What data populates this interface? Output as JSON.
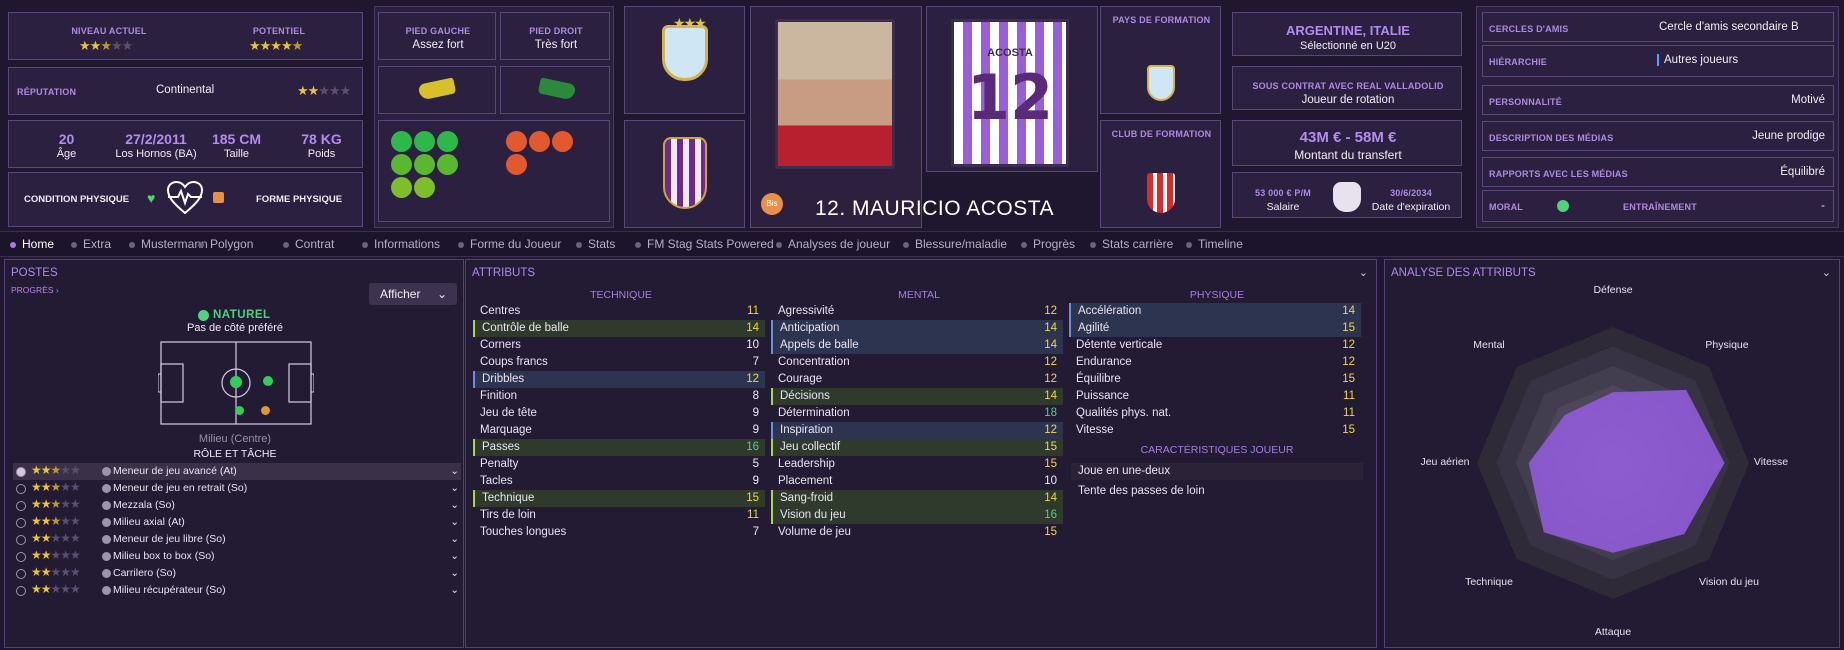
{
  "header": {
    "niveau_label": "NIVEAU ACTUEL",
    "potentiel_label": "POTENTIEL",
    "reputation_label": "RÉPUTATION",
    "reputation_value": "Continental",
    "age": "20",
    "age_label": "Âge",
    "birth": "27/2/2011",
    "birthplace": "Los Hornos (BA)",
    "height": "185 CM",
    "height_label": "Taille",
    "weight": "78 KG",
    "weight_label": "Poids",
    "condition_label": "CONDITION PHYSIQUE",
    "forme_label": "FORME PHYSIQUE",
    "pied_gauche_label": "PIED GAUCHE",
    "pied_gauche": "Assez fort",
    "pied_droit_label": "PIED DROIT",
    "pied_droit": "Très fort",
    "shirt_name": "ACOSTA",
    "shirt_number": "12",
    "player_title": "12. MAURICIO ACOSTA",
    "bis_badge": "Bis",
    "pays_formation_label": "PAYS DE FORMATION",
    "club_formation_label": "CLUB DE FORMATION",
    "nationality": "ARGENTINE, ITALIE",
    "selection": "Sélectionné en U20",
    "contract_label": "SOUS CONTRAT AVEC REAL VALLADOLID",
    "contract_role": "Joueur de rotation",
    "transfer_value": "43M € - 58M €",
    "transfer_label": "Montant du transfert",
    "salary": "53 000 € P/M",
    "salary_label": "Salaire",
    "expiry": "30/6/2034",
    "expiry_label": "Date d'expiration"
  },
  "info": [
    {
      "label": "CERCLES D'AMIS",
      "value": "Cercle d'amis secondaire B"
    },
    {
      "label": "HIÉRARCHIE",
      "value": "Autres joueurs"
    },
    {
      "label": "PERSONNALITÉ",
      "value": "Motivé"
    },
    {
      "label": "DESCRIPTION DES MÉDIAS",
      "value": "Jeune prodige"
    },
    {
      "label": "RAPPORTS AVEC LES MÉDIAS",
      "value": "Équilibré"
    }
  ],
  "moral_label": "MORAL",
  "entrainement_label": "ENTRAÎNEMENT",
  "entrainement_value": "-",
  "tabs": [
    "Home",
    "Extra",
    "Mustermann",
    "Polygon",
    "Contrat",
    "Informations",
    "Forme du Joueur",
    "Stats",
    "FM Stag Stats Powered",
    "Analyses de joueur",
    "Blessure/maladie",
    "Progrès",
    "Stats carrière",
    "Timeline"
  ],
  "postes": {
    "title": "POSTES",
    "progres": "PROGRÈS",
    "afficher": "Afficher",
    "naturel": "NATUREL",
    "side": "Pas de côté préféré",
    "position": "Milieu (Centre)",
    "role_title": "RÔLE ET TÂCHE",
    "roles": [
      {
        "name": "Meneur de jeu avancé (At)",
        "stars": 2.5
      },
      {
        "name": "Meneur de jeu en retrait (So)",
        "stars": 2.5
      },
      {
        "name": "Mezzala (So)",
        "stars": 2.5
      },
      {
        "name": "Milieu axial (At)",
        "stars": 2.5
      },
      {
        "name": "Meneur de jeu libre (So)",
        "stars": 2
      },
      {
        "name": "Milieu box to box (So)",
        "stars": 2
      },
      {
        "name": "Carrilero (So)",
        "stars": 2
      },
      {
        "name": "Milieu récupérateur (So)",
        "stars": 2
      }
    ]
  },
  "attributs": {
    "title": "ATTRIBUTS",
    "technique_label": "TECHNIQUE",
    "mental_label": "MENTAL",
    "physique_label": "PHYSIQUE",
    "carac_label": "CARACTÉRISTIQUES JOUEUR",
    "technique": [
      [
        "Centres",
        "11"
      ],
      [
        "Contrôle de balle",
        "14"
      ],
      [
        "Corners",
        "10"
      ],
      [
        "Coups francs",
        "7"
      ],
      [
        "Dribbles",
        "12"
      ],
      [
        "Finition",
        "8"
      ],
      [
        "Jeu de tête",
        "9"
      ],
      [
        "Marquage",
        "9"
      ],
      [
        "Passes",
        "16"
      ],
      [
        "Penalty",
        "5"
      ],
      [
        "Tacles",
        "9"
      ],
      [
        "Technique",
        "15"
      ],
      [
        "Tirs de loin",
        "11"
      ],
      [
        "Touches longues",
        "7"
      ]
    ],
    "mental": [
      [
        "Agressivité",
        "12"
      ],
      [
        "Anticipation",
        "14"
      ],
      [
        "Appels de balle",
        "14"
      ],
      [
        "Concentration",
        "12"
      ],
      [
        "Courage",
        "12"
      ],
      [
        "Décisions",
        "14"
      ],
      [
        "Détermination",
        "18"
      ],
      [
        "Inspiration",
        "12"
      ],
      [
        "Jeu collectif",
        "15"
      ],
      [
        "Leadership",
        "15"
      ],
      [
        "Placement",
        "10"
      ],
      [
        "Sang-froid",
        "14"
      ],
      [
        "Vision du jeu",
        "16"
      ],
      [
        "Volume de jeu",
        "15"
      ]
    ],
    "physique": [
      [
        "Accélération",
        "14"
      ],
      [
        "Agilité",
        "15"
      ],
      [
        "Détente verticale",
        "12"
      ],
      [
        "Endurance",
        "12"
      ],
      [
        "Équilibre",
        "15"
      ],
      [
        "Puissance",
        "11"
      ],
      [
        "Qualités phys. nat.",
        "11"
      ],
      [
        "Vitesse",
        "15"
      ]
    ],
    "carac": [
      "Joue en une-deux",
      "Tente des passes de loin"
    ]
  },
  "analyse": {
    "title": "ANALYSE DES ATTRIBUTS",
    "labels": [
      "Défense",
      "Physique",
      "Vitesse",
      "Vision du jeu",
      "Attaque",
      "Technique",
      "Jeu aérien",
      "Mental"
    ]
  },
  "colors": {
    "accent": "#a77ce8",
    "highlight": "#e9c43a",
    "good": "#4fd37a"
  }
}
